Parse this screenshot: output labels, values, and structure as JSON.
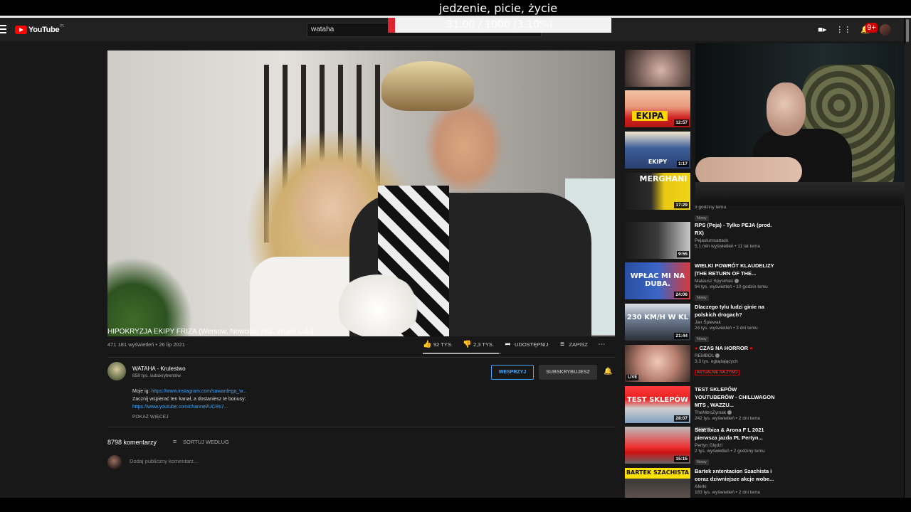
{
  "overlay": {
    "stream_title": "jedzenie, picie, życie",
    "goal_text": "31.00 / 1000 (3.10%)",
    "goal_fraction": 0.031
  },
  "masthead": {
    "logo_text": "YouTube",
    "country_code": "PL",
    "search_value": "wataha",
    "notification_count": "9+"
  },
  "video": {
    "title": "HIPOKRYZJA EKIPY FRIZA (Wersow, Nowciax, Friz, Wujek Luki)",
    "views_date": "471 181 wyświetleń • 26 lip 2021",
    "likes": "92 TYS.",
    "dislikes": "2,3 TYS.",
    "share": "UDOSTĘPNIJ",
    "save": "ZAPISZ",
    "like_ratio": 0.976
  },
  "channel": {
    "name": "WATAHA - Krulestwo",
    "subs": "858 tys. subskrybentów",
    "support": "WESPRZYJ",
    "subscribe": "SUBSKRYBUJESZ"
  },
  "description": {
    "line1_prefix": "Moje ig: ",
    "line1_link": "https://www.instagram.com/sawardega_w...",
    "line2": "Zacznij wspierać ten kanał, a dostaniesz te bonusy:",
    "line3_link": "https://www.youtube.com/channel/UCRs7...",
    "show_more": "POKAŻ WIĘCEJ"
  },
  "comments": {
    "count": "8798 komentarzy",
    "sort": "SORTUJ WEDŁUG",
    "placeholder": "Dodaj publiczny komentarz..."
  },
  "thumbs_top": [
    {
      "duration": "",
      "caption": ""
    },
    {
      "duration": "12:57",
      "caption": "EKIPA"
    },
    {
      "duration": "1:17",
      "caption": "EKIPY"
    },
    {
      "duration": "17:29",
      "caption": "MERGHANI"
    }
  ],
  "rec_partial": {
    "stats": "3 godziny temu",
    "badge": "Nowy"
  },
  "recommendations": [
    {
      "title": "RPS (Peja) - Tylko PEJA (prod. RX)",
      "channel": "Pejaslumsattack",
      "verified": false,
      "stats": "5,1 mln wyświetleń • 11 lat temu",
      "badge": "",
      "duration": "9:55",
      "caption": ""
    },
    {
      "title": "WIELKI POWRÓT KLAUDELIZY |THE RETURN OF THE...",
      "channel": "Mateusz Spysiński",
      "verified": true,
      "stats": "94 tys. wyświetleń • 10 godzin temu",
      "badge": "Nowy",
      "duration": "24:06",
      "caption": "WPŁAC MI NA DUBA."
    },
    {
      "title": "Dlaczego tylu ludzi ginie na polskich drogach?",
      "channel": "Jan Śpiewak",
      "verified": false,
      "stats": "24 tys. wyświetleń • 3 dni temu",
      "badge": "Nowy",
      "duration": "21:44",
      "caption": "230 KM/H W KL"
    },
    {
      "title": "CZAS NA HORROR",
      "channel": "REMBOL",
      "verified": true,
      "stats": "3,3 tys. oglądających",
      "badge": "AKTUALNIE NA ŻYWO",
      "duration": "",
      "live": "LIVE",
      "caption": ""
    },
    {
      "title": "TEST SKLEPÓW YOUTUBERÓW - CHILLWAGON MTS , WAZZU...",
      "channel": "TheNitroZyniak",
      "verified": true,
      "stats": "242 tys. wyświetleń • 2 dni temu",
      "badge": "Nowy",
      "duration": "28:07",
      "caption": "TEST SKLEPÓW"
    },
    {
      "title": "Seat Ibiza & Arona F L 2021 pierwsza jazda PL Pertyn...",
      "channel": "Pertyn Ględzi",
      "verified": false,
      "stats": "2 tys. wyświetleń • 2 godziny temu",
      "badge": "Nowy",
      "duration": "15:15",
      "caption": ""
    },
    {
      "title": "Bartek xntentacion Szachista i coraz dziwniejsze akcje wobe...",
      "channel": "Aferki",
      "verified": false,
      "stats": "183 tys. wyświetleń • 2 dni temu",
      "badge": "",
      "duration": "",
      "caption": "BARTEK SZACHISTA"
    }
  ]
}
